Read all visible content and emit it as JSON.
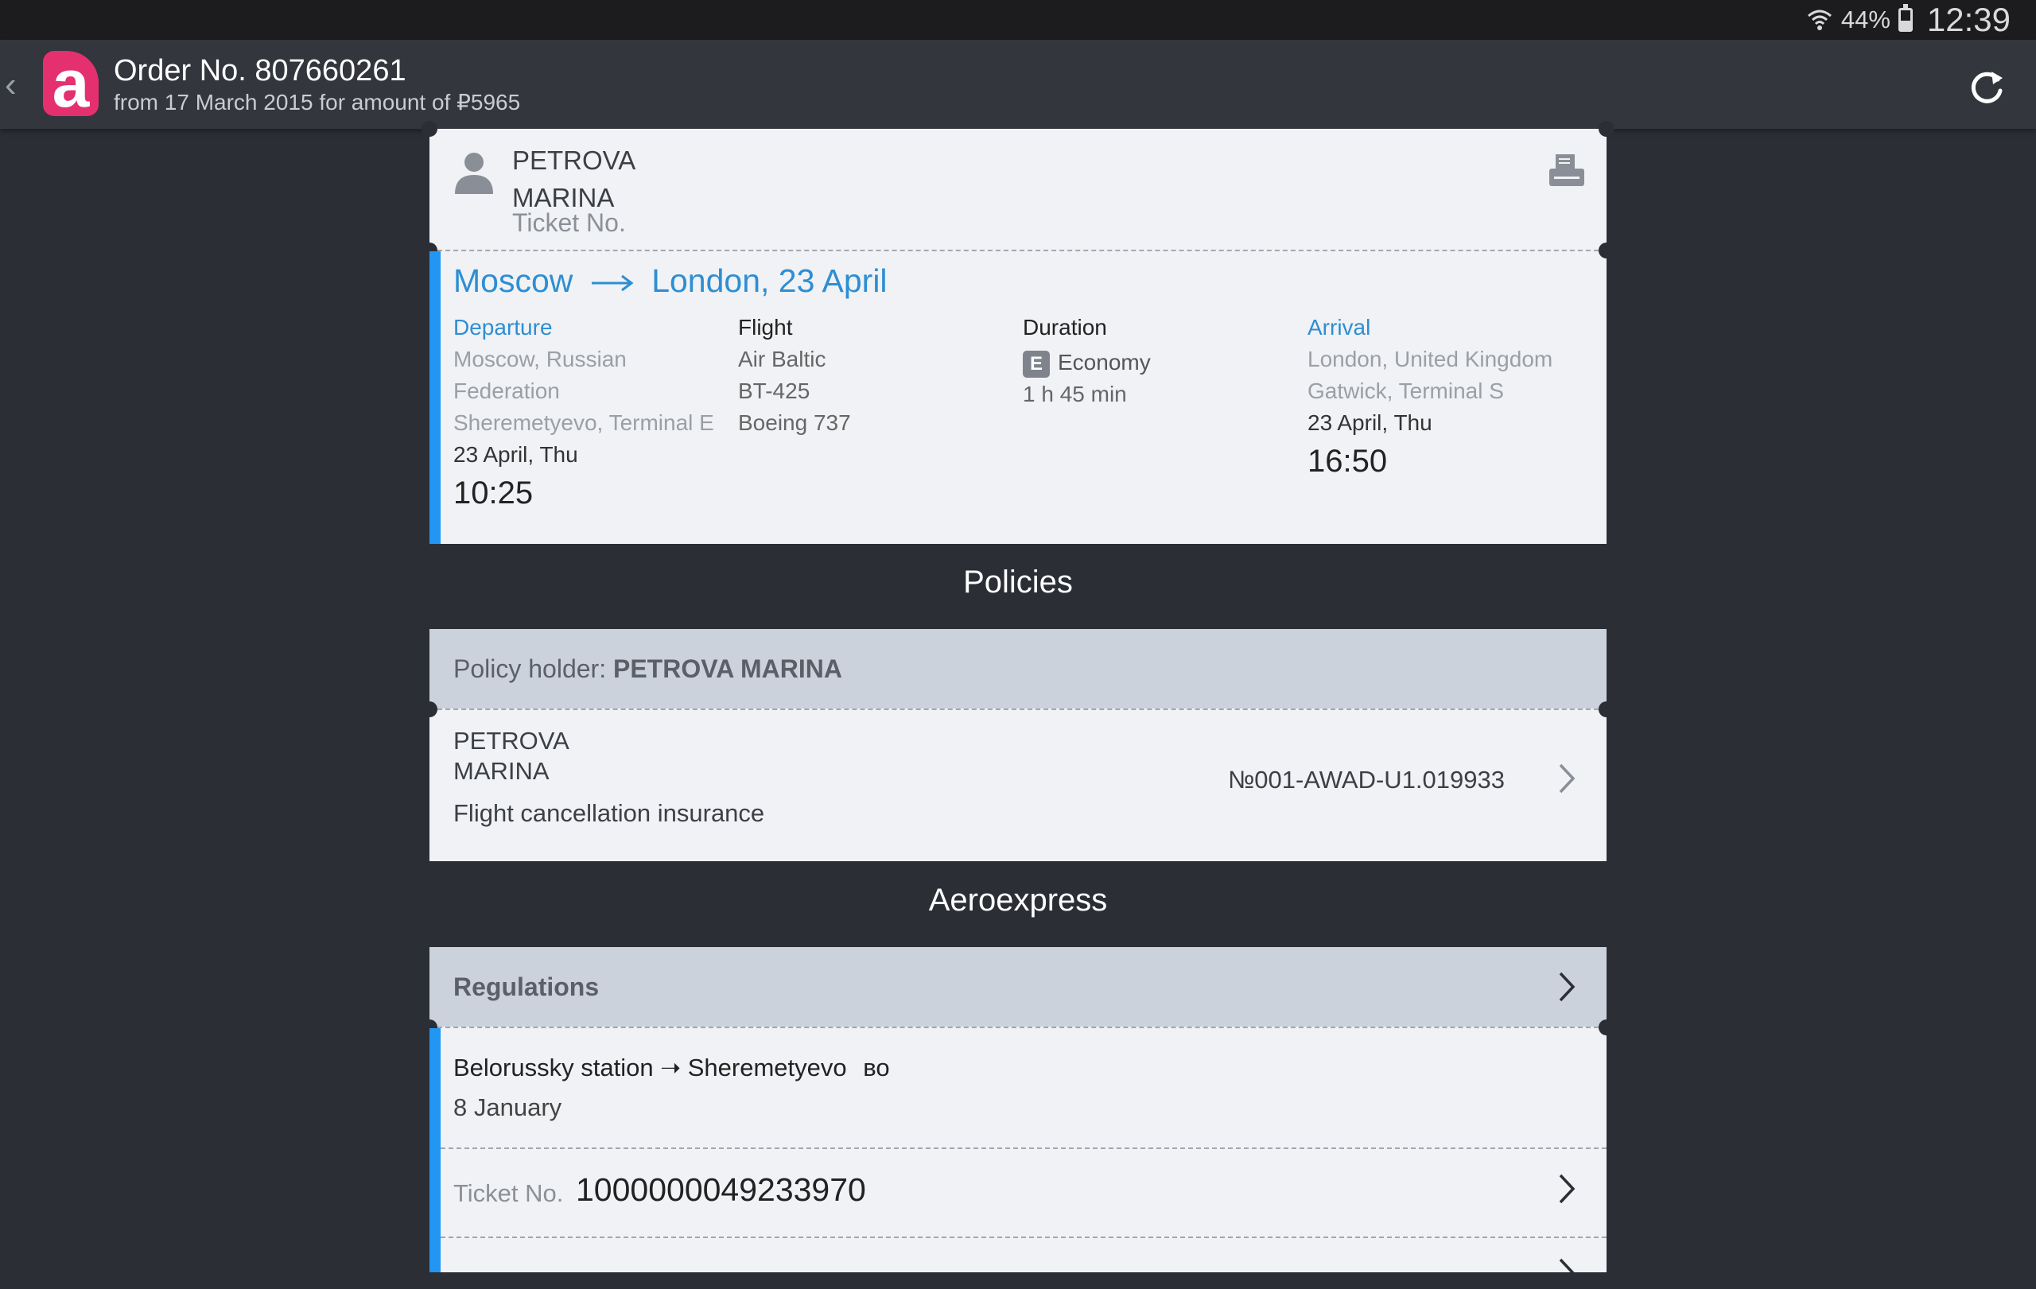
{
  "status_bar": {
    "battery_percent": "44%",
    "battery_level": 0.44,
    "time": "12:39"
  },
  "app_bar": {
    "back": "‹",
    "logo_letter": "a",
    "title": "Order No. 807660261",
    "subtitle": "from 17 March 2015 for amount of  ₽5965"
  },
  "passenger": {
    "first_line": "PETROVA",
    "second_line": "MARINA",
    "ticket_label": "Ticket No."
  },
  "flight": {
    "origin": "Moscow",
    "destination_date": "London, 23 April",
    "departure": {
      "heading": "Departure",
      "line1": "Moscow, Russian",
      "line2": "Federation",
      "line3": "Sheremetyevo, Terminal E",
      "date": "23 April, Thu",
      "time": "10:25"
    },
    "flight_info": {
      "heading": "Flight",
      "airline": "Air Baltic",
      "number": "BT-425",
      "aircraft": "Boeing 737"
    },
    "duration": {
      "heading": "Duration",
      "class_badge": "E",
      "class_name": "Economy",
      "value": "1 h 45 min"
    },
    "arrival": {
      "heading": "Arrival",
      "line1": "London, United Kingdom",
      "line2": "Gatwick, Terminal S",
      "date": "23 April, Thu",
      "time": "16:50"
    }
  },
  "policies": {
    "heading": "Policies",
    "holder_label": "Policy holder: ",
    "holder_name": "PETROVA MARINA",
    "insured_first": "PETROVA",
    "insured_second": "MARINA",
    "type": "Flight cancellation insurance",
    "number": "№001-AWAD-U1.019933"
  },
  "aeroexpress": {
    "heading": "Aeroexpress",
    "regulations": "Regulations",
    "route": "Belorussky station ➝ Sheremetyevo",
    "route_suffix": "во",
    "date": "8 January",
    "ticket_label": "Ticket No.",
    "ticket_number": "1000000049233970"
  },
  "colors": {
    "background": "#2b2e35",
    "accent_blue": "#2196f3",
    "link_blue": "#2e8ed2",
    "brand_pink": "#e4306f",
    "card": "#f0f2f5",
    "section_header": "#cbd2dc"
  }
}
